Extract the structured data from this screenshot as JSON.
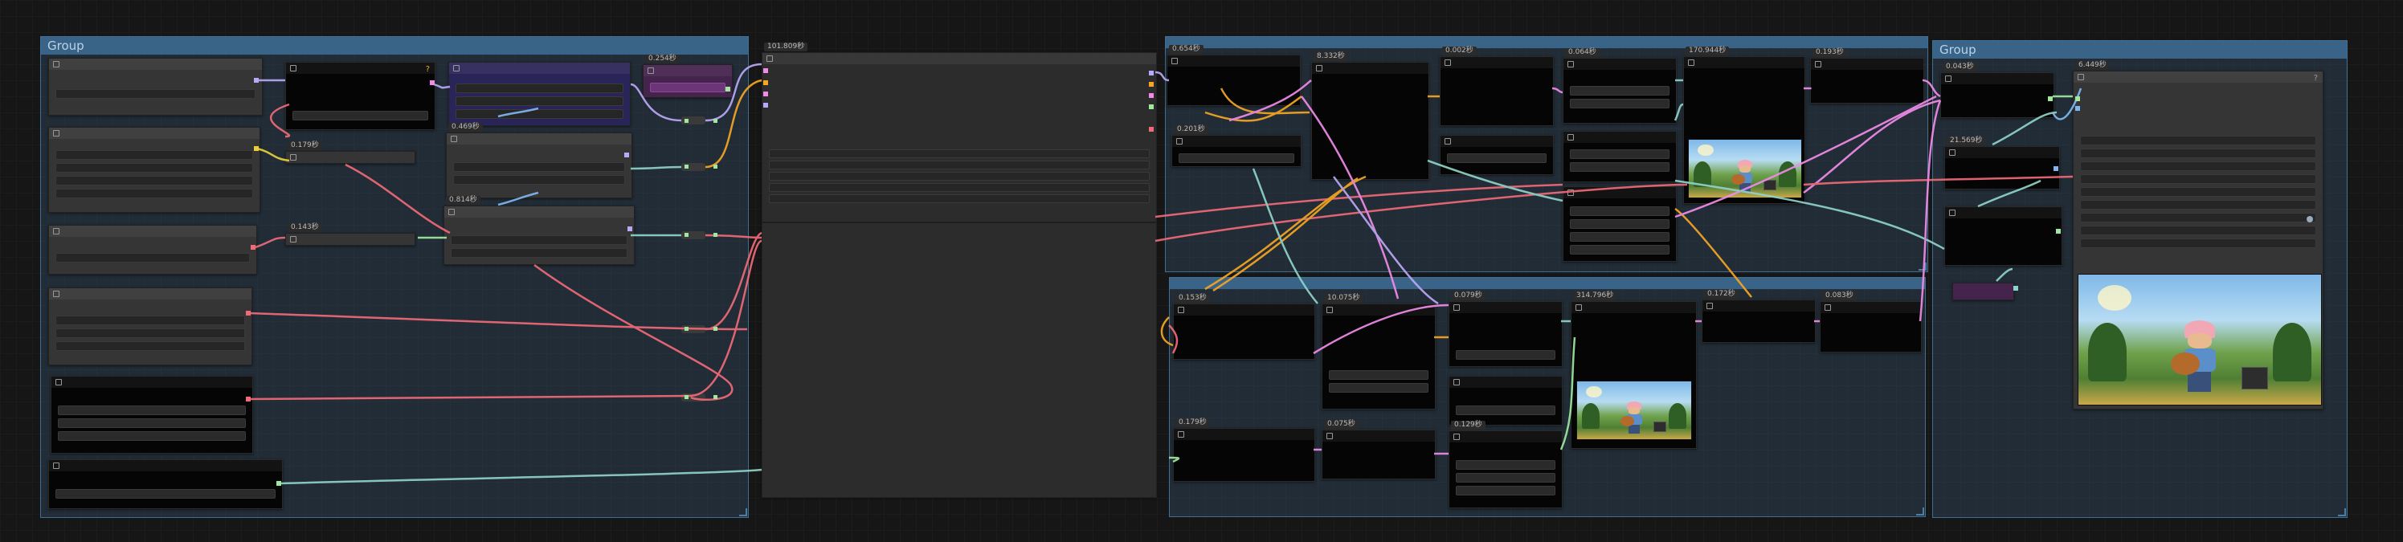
{
  "canvas": {
    "background": "#161616"
  },
  "groups": [
    {
      "id": "g1",
      "title": "Group"
    },
    {
      "id": "g2",
      "title": ""
    },
    {
      "id": "g3",
      "title": ""
    },
    {
      "id": "g4",
      "title": "Group"
    }
  ],
  "badges": {
    "b1": "0.254秒",
    "b2": "0.179秒",
    "b3": "0.469秒",
    "b4": "0.814秒",
    "b5": "0.143秒",
    "b6": "101.809秒",
    "b7": "0.654秒",
    "b8": "8.332秒",
    "b9": "0.002秒",
    "b10": "0.064秒",
    "b11": "170.944秒",
    "b12": "0.193秒",
    "b13": "0.201秒",
    "b14": "0.153秒",
    "b15": "10.075秒",
    "b16": "0.079秒",
    "b17": "314.796秒",
    "b18": "0.172秒",
    "b19": "0.083秒",
    "b20": "0.179秒",
    "b21": "0.075秒",
    "b22": "0.129秒",
    "b23": "0.043秒",
    "b24": "21.569秒",
    "b25": "6.449秒"
  },
  "colors": {
    "wire_pink": "#f08ce8",
    "wire_red": "#f06a78",
    "wire_orange": "#f5a623",
    "wire_lavender": "#b9a8f5",
    "wire_teal": "#8fd3c8",
    "wire_blue": "#7fb7f0",
    "wire_yellow": "#e8d03a",
    "wire_green": "#9fe8a0"
  },
  "icons": [
    "collapse-icon",
    "help-icon",
    "image-thumbnail"
  ]
}
